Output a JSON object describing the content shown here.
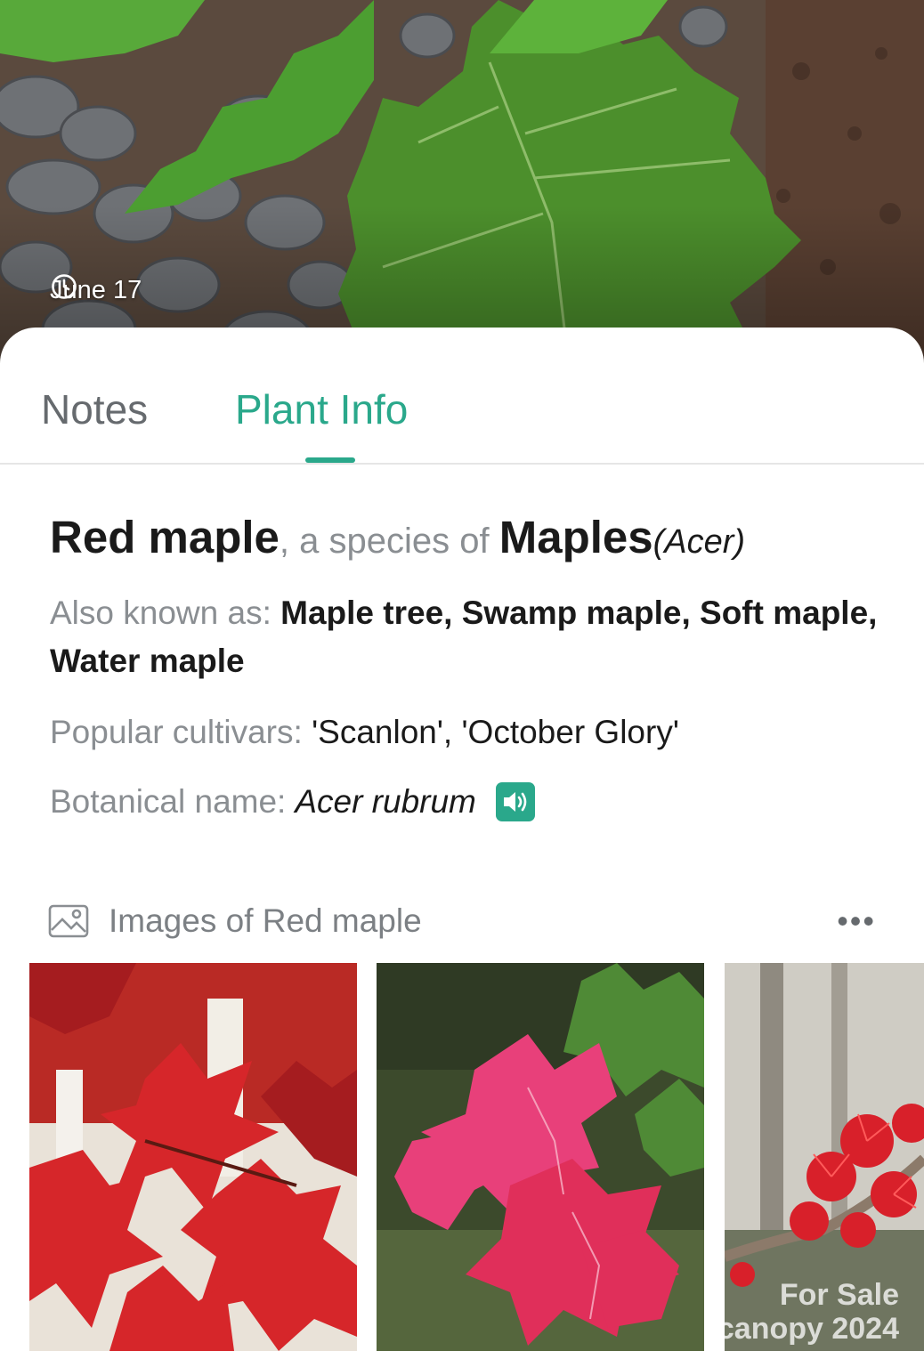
{
  "hero": {
    "date": "June 17",
    "icon": "clock-icon"
  },
  "tabs": [
    {
      "label": "Notes",
      "active": false
    },
    {
      "label": "Plant Info",
      "active": true
    }
  ],
  "colors": {
    "accent": "#2aa88b",
    "muted_text": "#8a8e92",
    "primary_text": "#1a1a1a"
  },
  "plant": {
    "common_name": "Red maple",
    "species_of_text": ", a species of ",
    "genus_common": "Maples",
    "genus_latin": "(Acer)",
    "also_known_label": "Also known as: ",
    "also_known_value": "Maple tree, Swamp maple, Soft maple, Water maple",
    "cultivars_label": "Popular cultivars: ",
    "cultivars_value": "'Scanlon', 'October Glory'",
    "botanical_label": "Botanical name:",
    "botanical_value": "Acer rubrum",
    "speaker_icon": "speaker-icon"
  },
  "images": {
    "title": "Images of Red maple",
    "icon": "gallery-icon",
    "more_icon": "more-icon",
    "more_label": "•••",
    "thumbnails": [
      {
        "subject": "red-maple-leaves-autumn"
      },
      {
        "subject": "pink-red-maple-leaves-ground"
      },
      {
        "subject": "red-maple-flowers"
      }
    ],
    "watermark_line1": "For Sale",
    "watermark_line2": "canopy 2024"
  }
}
